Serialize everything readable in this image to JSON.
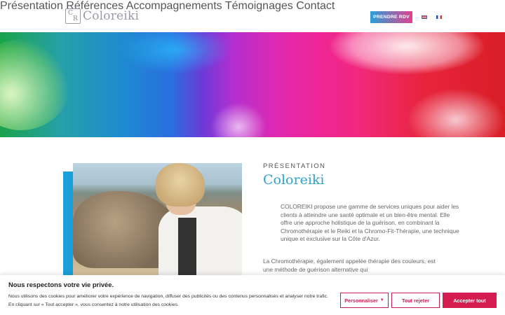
{
  "header": {
    "logo_text": "Coloreiki",
    "logo_mark_1": "C",
    "logo_mark_2": "R",
    "nav": [
      "Présentation",
      "Références",
      "Accompagnements",
      "Témoignages",
      "Contact"
    ],
    "cta_label": "PRENDRE RDV",
    "flags": [
      "english-flag-icon",
      "french-flag-icon"
    ]
  },
  "hero": {
    "palette": [
      "#1aa24a",
      "#1e8bd0",
      "#b22fd0",
      "#ee2596",
      "#d81e26"
    ]
  },
  "main": {
    "eyebrow": "PRÉSENTATION",
    "title": "Coloreiki",
    "para1": "COLOREIKI propose une gamme de services uniques pour aider les clients à atteindre une santé optimale et un bien-être mental. Elle offre une approche holistique de la guérison, en combinant la Chromothérapie et le Reiki et la Chromo-Fit-Thérapie, une technique unique et exclusive sur la Côte d'Azur.",
    "para2": "La Chromothérapie, également appelée thérapie des couleurs, est une méthode de guérison alternative qui"
  },
  "cookie": {
    "title": "Nous respectons votre vie privée.",
    "text": "Nous utilisons des cookies pour améliorer votre expérience de navigation, diffuser des publicités ou des contenus personnalisés et analyser notre trafic. En cliquant sur « Tout accepter », vous consentez à notre utilisation des cookies.",
    "customize_label": "Personnaliser",
    "reject_label": "Tout rejeter",
    "accept_label": "Accepter tout"
  },
  "colors": {
    "accent_blue": "#2ea3cf",
    "cookie_red": "#d51d52"
  }
}
